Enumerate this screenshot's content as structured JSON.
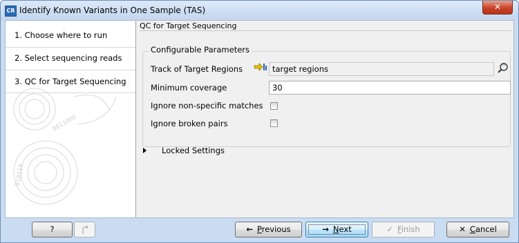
{
  "window": {
    "app_icon_text": "CR",
    "title": "Identify Known Variants in One Sample (TAS)",
    "close_glyph": "✕"
  },
  "steps": [
    {
      "label": "1.  Choose where to run"
    },
    {
      "label": "2.  Select sequencing reads"
    },
    {
      "label": "3.  QC for Target Sequencing"
    }
  ],
  "section": {
    "title": "QC for Target Sequencing",
    "group_title": "Configurable Parameters"
  },
  "params": {
    "track_label": "Track of Target Regions",
    "track_value": "target regions",
    "min_coverage_label": "Minimum coverage",
    "min_coverage_value": "30",
    "ignore_nonspecific_label": "Ignore non-specific matches",
    "ignore_nonspecific_checked": false,
    "ignore_broken_label": "Ignore broken pairs",
    "ignore_broken_checked": false
  },
  "locked_settings": {
    "label": "Locked Settings",
    "expanded": false
  },
  "buttons": {
    "help": "?",
    "previous_glyph": "←",
    "previous_mnemonic": "P",
    "previous_rest": "revious",
    "next_glyph": "→",
    "next_mnemonic": "N",
    "next_rest": "ext",
    "finish_glyph": "✓",
    "finish_mnemonic": "F",
    "finish_rest": "inish",
    "cancel_glyph": "✕",
    "cancel_mnemonic": "C",
    "cancel_rest": "ancel"
  },
  "colors": {
    "accent": "#3c7fb1",
    "close": "#c8432a",
    "title_gradient_top": "#dce9f8"
  }
}
